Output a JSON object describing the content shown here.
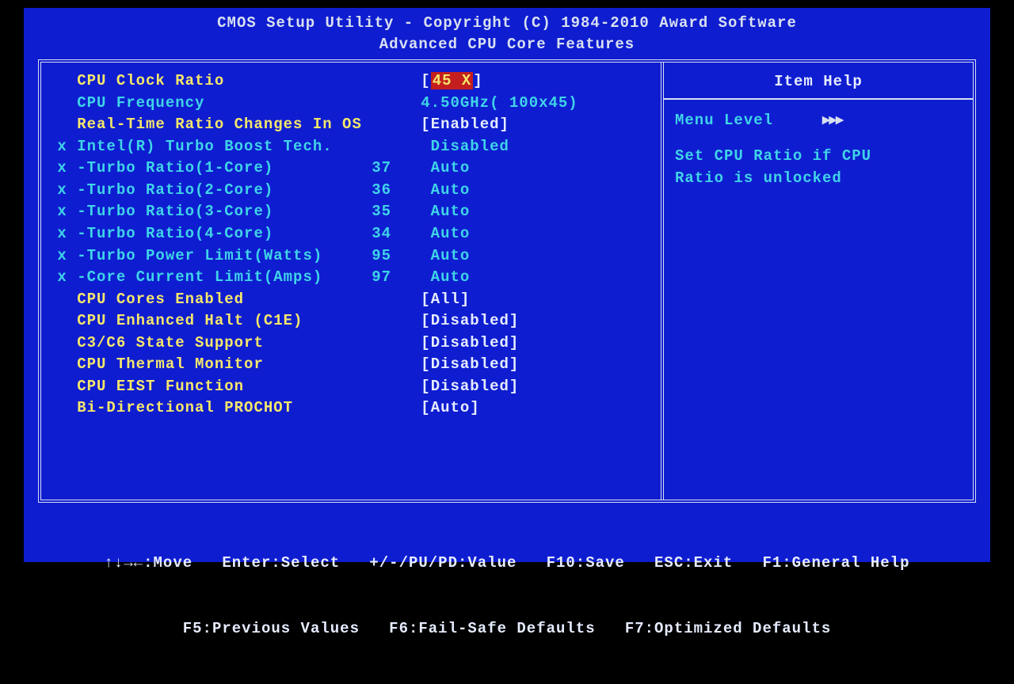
{
  "header": {
    "line1": "CMOS Setup Utility - Copyright (C) 1984-2010 Award Software",
    "line2": "Advanced CPU Core Features"
  },
  "settings": [
    {
      "kind": "normal",
      "indent": "   ",
      "label": "CPU Clock Ratio",
      "sub": "",
      "value": "45 X",
      "brackets": true,
      "highlight": true
    },
    {
      "kind": "info",
      "indent": "   ",
      "label": "CPU Frequency",
      "sub": "",
      "value": "4.50GHz( 100x45)",
      "brackets": false
    },
    {
      "kind": "normal",
      "indent": "   ",
      "label": "Real-Time Ratio Changes In OS",
      "sub": "",
      "value": "Enabled",
      "brackets": true
    },
    {
      "kind": "disabled",
      "indent": " x ",
      "label": "Intel(R) Turbo Boost Tech.",
      "sub": "",
      "value": "Disabled",
      "brackets": false
    },
    {
      "kind": "disabled",
      "indent": " x ",
      "label": "-Turbo Ratio(1-Core)",
      "sub": "37",
      "value": "Auto",
      "brackets": false
    },
    {
      "kind": "disabled",
      "indent": " x ",
      "label": "-Turbo Ratio(2-Core)",
      "sub": "36",
      "value": "Auto",
      "brackets": false
    },
    {
      "kind": "disabled",
      "indent": " x ",
      "label": "-Turbo Ratio(3-Core)",
      "sub": "35",
      "value": "Auto",
      "brackets": false
    },
    {
      "kind": "disabled",
      "indent": " x ",
      "label": "-Turbo Ratio(4-Core)",
      "sub": "34",
      "value": "Auto",
      "brackets": false
    },
    {
      "kind": "disabled",
      "indent": " x ",
      "label": "-Turbo Power Limit(Watts)",
      "sub": "95",
      "value": "Auto",
      "brackets": false
    },
    {
      "kind": "disabled",
      "indent": " x ",
      "label": "-Core Current Limit(Amps)",
      "sub": "97",
      "value": "Auto",
      "brackets": false
    },
    {
      "kind": "normal",
      "indent": "   ",
      "label": "CPU Cores Enabled",
      "sub": "",
      "value": "All",
      "brackets": true
    },
    {
      "kind": "normal",
      "indent": "   ",
      "label": "CPU Enhanced Halt (C1E)",
      "sub": "",
      "value": "Disabled",
      "brackets": true
    },
    {
      "kind": "normal",
      "indent": "   ",
      "label": "C3/C6 State Support",
      "sub": "",
      "value": "Disabled",
      "brackets": true
    },
    {
      "kind": "normal",
      "indent": "   ",
      "label": "CPU Thermal Monitor",
      "sub": "",
      "value": "Disabled",
      "brackets": true
    },
    {
      "kind": "normal",
      "indent": "   ",
      "label": "CPU EIST Function",
      "sub": "",
      "value": "Disabled",
      "brackets": true
    },
    {
      "kind": "normal",
      "indent": "   ",
      "label": "Bi-Directional PROCHOT",
      "sub": "",
      "value": "Auto",
      "brackets": true
    }
  ],
  "help": {
    "title": "Item Help",
    "menu_level_label": "Menu Level",
    "arrows": "▸▸▸",
    "body": "Set CPU Ratio if CPU\nRatio is unlocked"
  },
  "footer": {
    "line1": "↑↓→←:Move   Enter:Select   +/-/PU/PD:Value   F10:Save   ESC:Exit   F1:General Help",
    "line2": "F5:Previous Values   F6:Fail-Safe Defaults   F7:Optimized Defaults"
  },
  "layout": {
    "labelWidth": 30,
    "subWidth": 5
  }
}
